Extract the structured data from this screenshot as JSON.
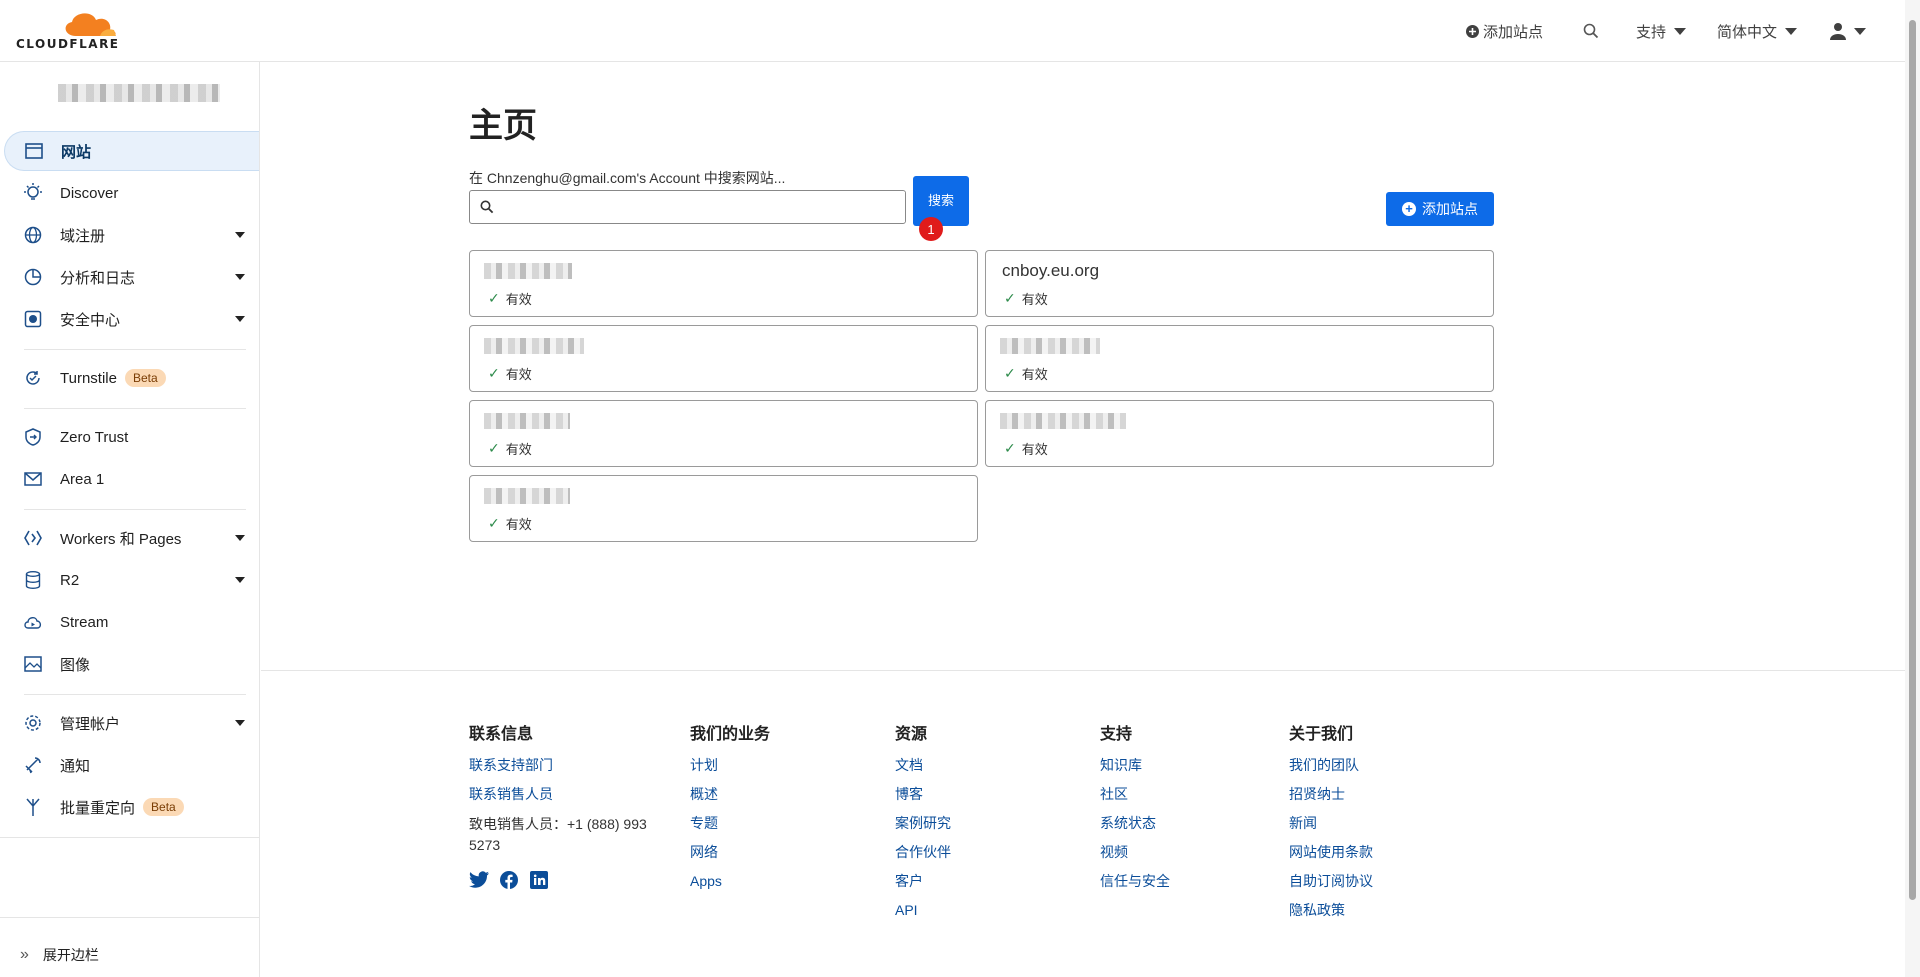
{
  "brand": {
    "name": "CLOUDFLARE",
    "accent": "#f38020",
    "primary": "#0d6be8"
  },
  "header": {
    "add_site": "添加站点",
    "support": "支持",
    "language": "简体中文"
  },
  "sidebar": {
    "items": [
      {
        "label": "网站",
        "icon": "browser-icon"
      },
      {
        "label": "Discover",
        "icon": "lightbulb-icon"
      },
      {
        "label": "域注册",
        "icon": "globe-icon"
      },
      {
        "label": "分析和日志",
        "icon": "chart-pie-icon"
      },
      {
        "label": "安全中心",
        "icon": "shield-check-icon"
      },
      {
        "label": "Turnstile",
        "icon": "turnstile-icon",
        "badge": "Beta"
      },
      {
        "label": "Zero Trust",
        "icon": "zero-trust-icon"
      },
      {
        "label": "Area 1",
        "icon": "mail-icon"
      },
      {
        "label": "Workers 和 Pages",
        "icon": "workers-icon"
      },
      {
        "label": "R2",
        "icon": "database-icon"
      },
      {
        "label": "Stream",
        "icon": "cloud-play-icon"
      },
      {
        "label": "图像",
        "icon": "image-icon"
      },
      {
        "label": "管理帐户",
        "icon": "gear-icon"
      },
      {
        "label": "通知",
        "icon": "notification-icon"
      },
      {
        "label": "批量重定向",
        "icon": "redirect-icon",
        "badge": "Beta"
      }
    ],
    "expand": "展开边栏"
  },
  "main": {
    "title": "主页",
    "search_label": "在 Chnzenghu@gmail.com's Account 中搜索网站...",
    "search_button": "搜索",
    "add_site_button": "添加站点",
    "sites": [
      {
        "name": "",
        "status": "有效"
      },
      {
        "name": "cnboy.eu.org",
        "status": "有效",
        "notification": "1"
      },
      {
        "name": "",
        "status": "有效"
      },
      {
        "name": "",
        "status": "有效"
      },
      {
        "name": "",
        "status": "有效"
      },
      {
        "name": "",
        "status": "有效"
      },
      {
        "name": "",
        "status": "有效"
      }
    ]
  },
  "footer": {
    "contact": {
      "title": "联系信息",
      "links": [
        "联系支持部门",
        "联系销售人员"
      ],
      "phone": "致电销售人员：+1 (888) 993 5273"
    },
    "business": {
      "title": "我们的业务",
      "links": [
        "计划",
        "概述",
        "专题",
        "网络",
        "Apps"
      ]
    },
    "resources": {
      "title": "资源",
      "links": [
        "文档",
        "博客",
        "案例研究",
        "合作伙伴",
        "客户",
        "API"
      ]
    },
    "support": {
      "title": "支持",
      "links": [
        "知识库",
        "社区",
        "系统状态",
        "视频",
        "信任与安全"
      ]
    },
    "about": {
      "title": "关于我们",
      "links": [
        "我们的团队",
        "招贤纳士",
        "新闻",
        "网站使用条款",
        "自助订阅协议",
        "隐私政策"
      ]
    }
  }
}
